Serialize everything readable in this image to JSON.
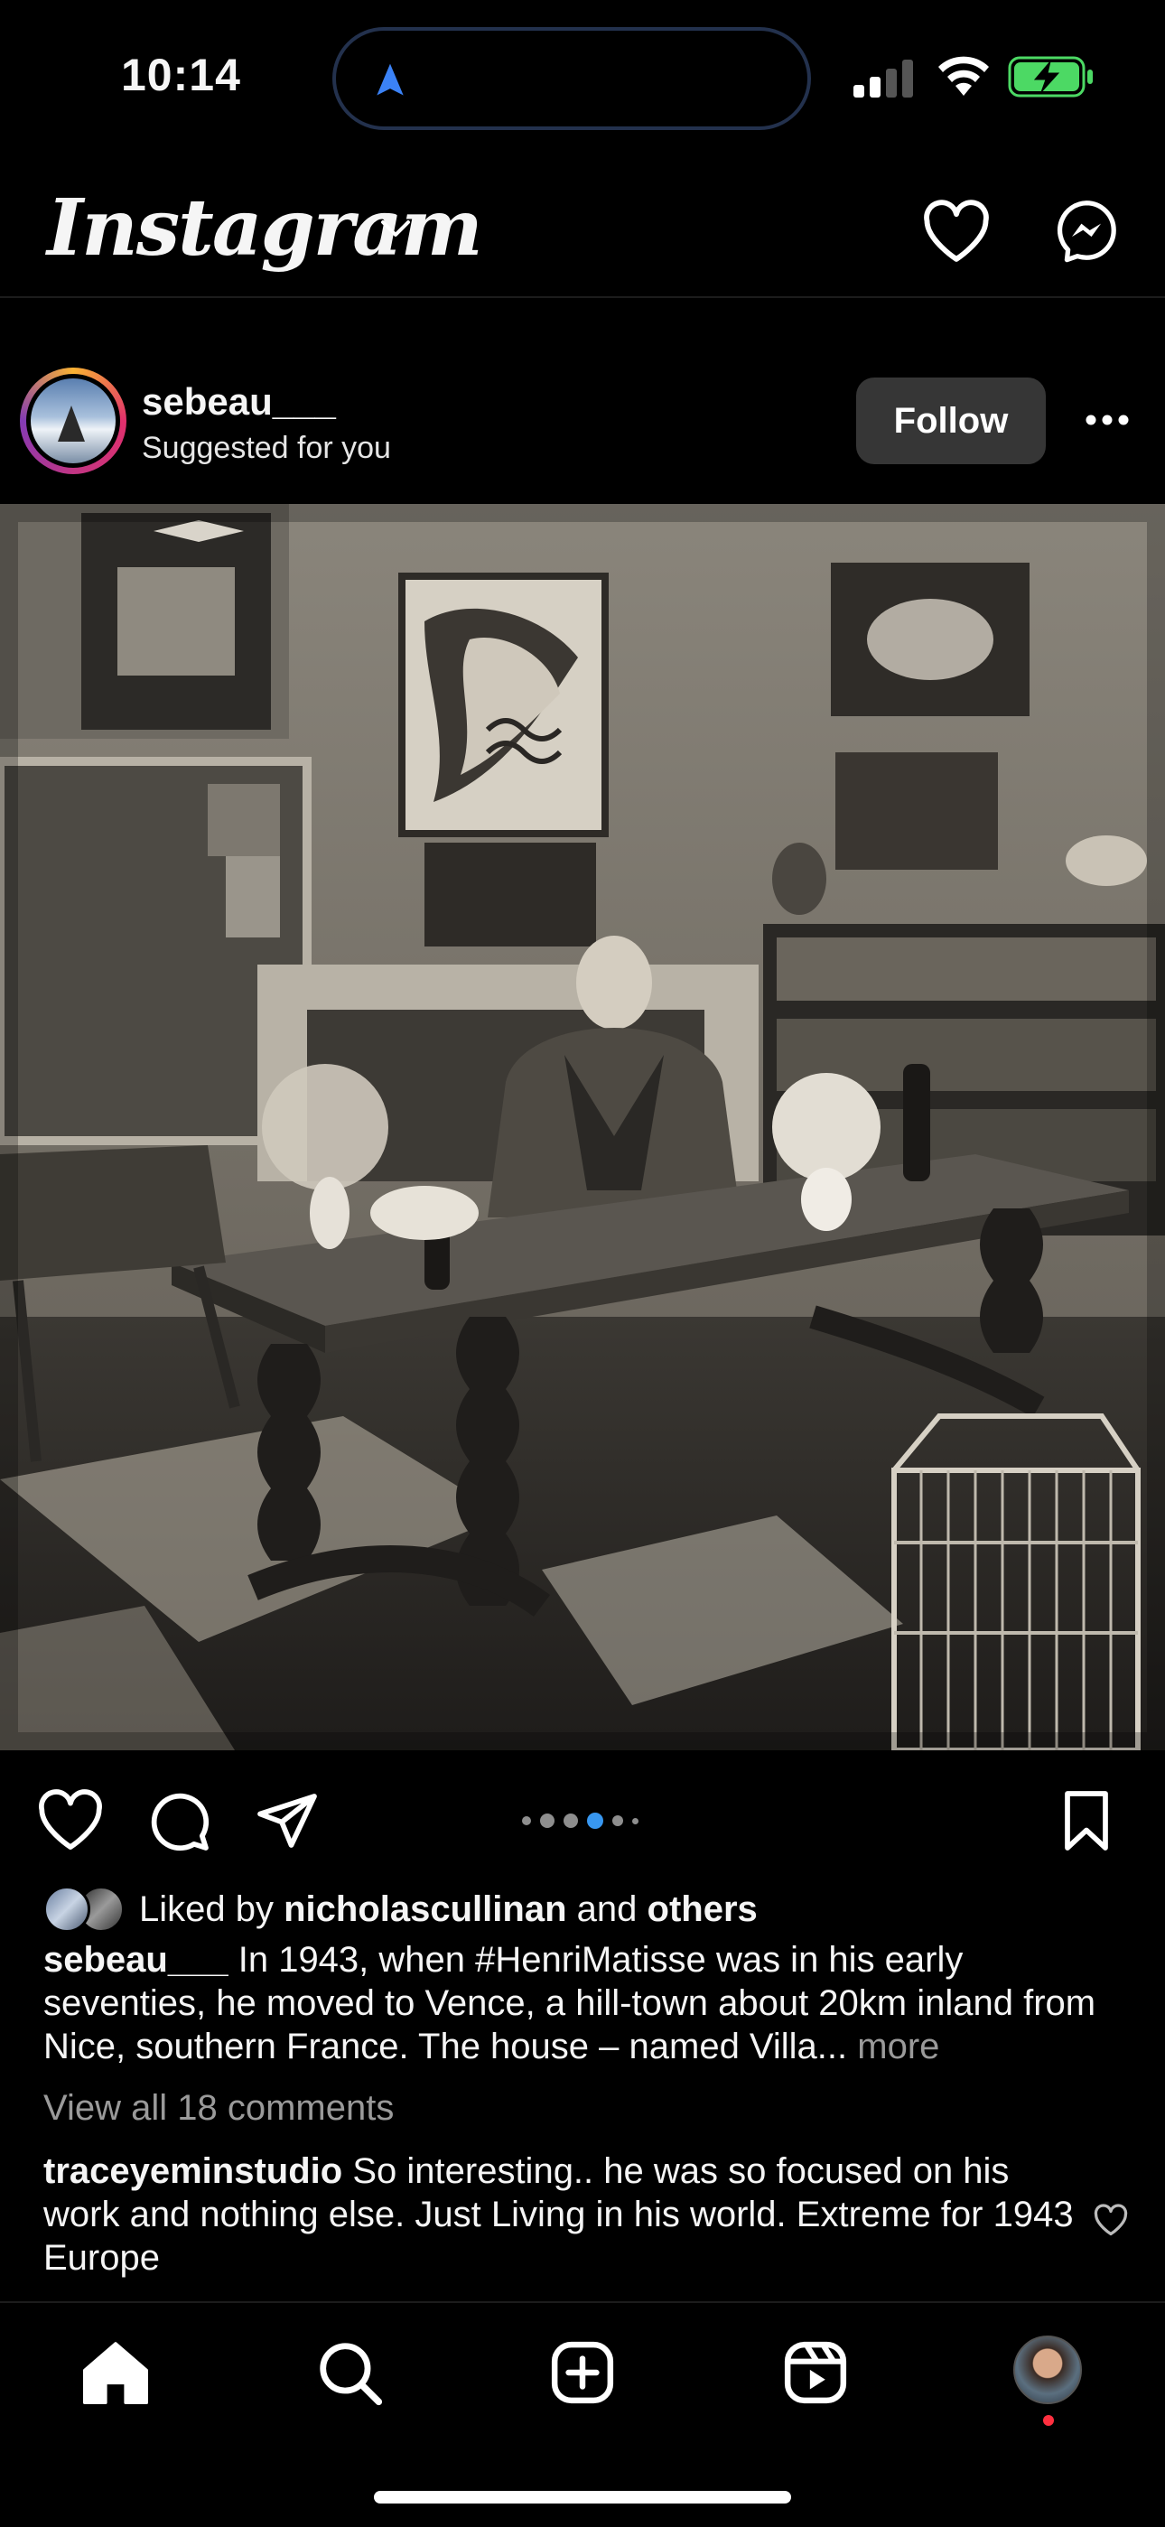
{
  "status_bar": {
    "time": "10:14",
    "battery_charging": true
  },
  "header": {
    "logo": "Instagram"
  },
  "post": {
    "username": "sebeau___",
    "subtitle": "Suggested for you",
    "follow_label": "Follow",
    "carousel": {
      "count": 6,
      "active_index": 3
    },
    "likes": {
      "prefix": "Liked by",
      "user": "nicholascullinan",
      "middle": "and",
      "others": "others"
    },
    "caption": {
      "username": "sebeau___",
      "text_before": "In 1943, when",
      "hashtag": "#HenriMatisse",
      "text_after": "was in his early seventies, he moved to Vence, a hill-town about 20km inland from Nice, southern France. The house – named Villa...",
      "more": "more"
    },
    "view_comments": "View all 18 comments",
    "top_comment": {
      "username": "traceyeminstudio",
      "text": "So interesting.. he was so focused on his work and nothing else. Just Living in his world. Extreme for 1943 Europe"
    }
  },
  "colors": {
    "accent": "#3897f0",
    "follow_bg": "#363636",
    "notification": "#ff3040"
  }
}
